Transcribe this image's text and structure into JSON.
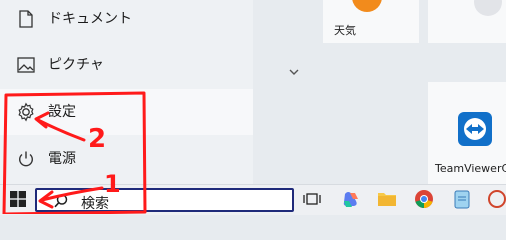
{
  "start_menu": {
    "items": [
      {
        "label": "ドキュメント",
        "icon": "document-icon"
      },
      {
        "label": "ピクチャ",
        "icon": "picture-icon"
      },
      {
        "label": "設定",
        "icon": "gear-icon"
      },
      {
        "label": "電源",
        "icon": "power-icon"
      }
    ]
  },
  "tiles": {
    "weather": {
      "label": "天気"
    },
    "teamviewer": {
      "label": "TeamViewerC"
    }
  },
  "taskbar": {
    "search_text": "検索",
    "icons": [
      "windows-start-icon",
      "task-view-icon",
      "copilot-icon",
      "file-explorer-icon",
      "chrome-icon",
      "notepad-icon",
      "app-icon"
    ]
  },
  "annotations": {
    "labels": [
      "1",
      "2"
    ],
    "color": "#ff1a1a"
  }
}
